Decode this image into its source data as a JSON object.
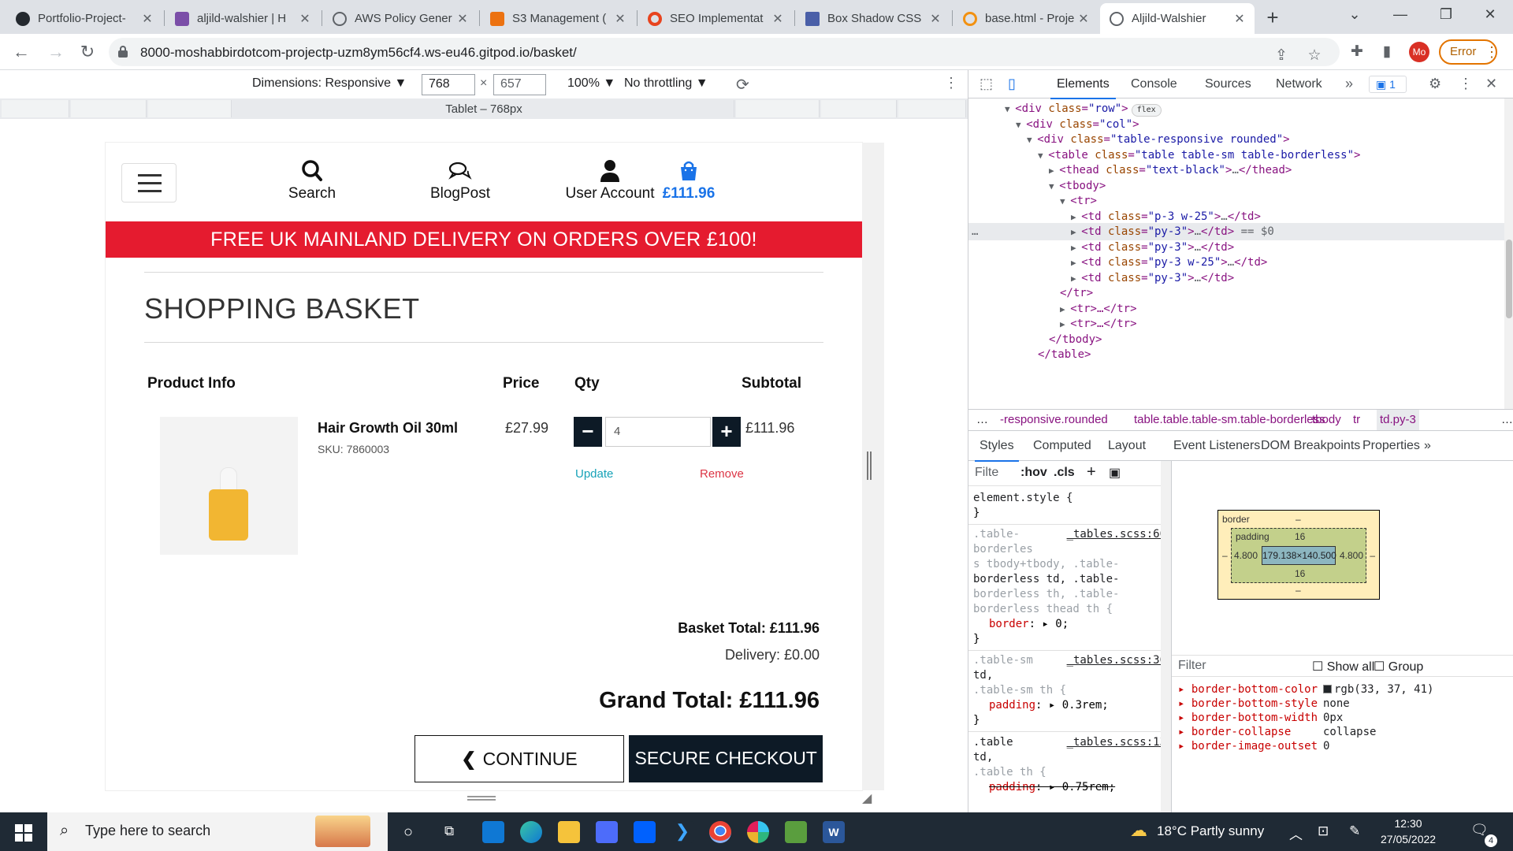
{
  "browser": {
    "tabs": [
      {
        "label": "Portfolio-Project-",
        "color": "#24292f"
      },
      {
        "label": "aljild-walshier | H",
        "color": "#7b4ea8"
      },
      {
        "label": "AWS Policy Gener",
        "color": "#5f6368"
      },
      {
        "label": "S3 Management (",
        "color": "#ec7211"
      },
      {
        "label": "SEO Implementat",
        "color": "#e8431e"
      },
      {
        "label": "Box Shadow CSS",
        "color": "#4a5fa8"
      },
      {
        "label": "base.html - Proje",
        "color": "#f29111"
      },
      {
        "label": "Aljild-Walshier",
        "color": "#5f6368"
      }
    ],
    "url": "8000-moshabbirdotcom-projectp-uzm8ym56cf4.ws-eu46.gitpod.io/basket/",
    "profile_initials": "Mo",
    "error_label": "Error"
  },
  "device_toolbar": {
    "dimensions_label": "Dimensions: Responsive ▼",
    "width": "768",
    "height": "657",
    "zoom": "100% ▼",
    "throttling": "No throttling ▼",
    "media_query_label": "Tablet – 768px"
  },
  "site": {
    "nav": {
      "search": "Search",
      "blog": "BlogPost",
      "account": "User Account",
      "cart_total": "£111.96"
    },
    "promo_banner": "FREE UK MAINLAND DELIVERY ON ORDERS OVER £100!",
    "page_title": "SHOPPING BASKET",
    "table_headers": {
      "product": "Product Info",
      "price": "Price",
      "qty": "Qty",
      "subtotal": "Subtotal"
    },
    "item": {
      "name": "Hair Growth Oil 30ml",
      "sku": "SKU: 7860003",
      "price": "£27.99",
      "qty": "4",
      "subtotal": "£111.96",
      "update": "Update",
      "remove": "Remove",
      "minus": "−",
      "plus": "+"
    },
    "totals": {
      "basket_total": "Basket Total: £111.96",
      "delivery": "Delivery: £0.00",
      "grand_total": "Grand Total: £111.96"
    },
    "buttons": {
      "continue": "CONTINUE SHOPPING",
      "checkout": "SECURE CHECKOUT"
    }
  },
  "devtools": {
    "tabs": [
      "Elements",
      "Console",
      "Sources",
      "Network"
    ],
    "issues_count": "1",
    "dom_lines": [
      {
        "indent": 0,
        "tri": "▼",
        "tag": "div",
        "attrs": [
          [
            "class",
            "row"
          ]
        ],
        "badge": "flex",
        "close": false
      },
      {
        "indent": 1,
        "tri": "▼",
        "tag": "div",
        "attrs": [
          [
            "class",
            "col"
          ]
        ],
        "close": false
      },
      {
        "indent": 2,
        "tri": "▼",
        "tag": "div",
        "attrs": [
          [
            "class",
            "table-responsive rounded"
          ]
        ],
        "close": false
      },
      {
        "indent": 3,
        "tri": "▼",
        "tag": "table",
        "attrs": [
          [
            "class",
            "table table-sm table-borderless"
          ]
        ],
        "close": false
      },
      {
        "indent": 4,
        "tri": "▶",
        "tag": "thead",
        "attrs": [
          [
            "class",
            "text-black"
          ]
        ],
        "close": true
      },
      {
        "indent": 4,
        "tri": "▼",
        "tag": "tbody",
        "attrs": [],
        "close": false
      },
      {
        "indent": 5,
        "tri": "▼",
        "tag": "tr",
        "attrs": [],
        "close": false
      },
      {
        "indent": 6,
        "tri": "▶",
        "tag": "td",
        "attrs": [
          [
            "class",
            "p-3 w-25"
          ]
        ],
        "close": true
      },
      {
        "indent": 6,
        "tri": "▶",
        "tag": "td",
        "attrs": [
          [
            "class",
            "py-3"
          ]
        ],
        "close": true,
        "selected": true,
        "suffix": " == $0"
      },
      {
        "indent": 6,
        "tri": "▶",
        "tag": "td",
        "attrs": [
          [
            "class",
            "py-3"
          ]
        ],
        "close": true
      },
      {
        "indent": 6,
        "tri": "▶",
        "tag": "td",
        "attrs": [
          [
            "class",
            "py-3 w-25"
          ]
        ],
        "close": true
      },
      {
        "indent": 6,
        "tri": "▶",
        "tag": "td",
        "attrs": [
          [
            "class",
            "py-3"
          ]
        ],
        "close": true
      },
      {
        "indent": 5,
        "tri": "",
        "raw": "</tr>"
      },
      {
        "indent": 5,
        "tri": "▶",
        "raw": "<tr>…</tr>"
      },
      {
        "indent": 5,
        "tri": "▶",
        "raw": "<tr>…</tr>"
      },
      {
        "indent": 4,
        "tri": "",
        "raw": "</tbody>"
      },
      {
        "indent": 3,
        "tri": "",
        "raw": "</table>"
      }
    ],
    "breadcrumbs": [
      "…",
      "-responsive.rounded",
      "table.table.table-sm.table-borderless",
      "tbody",
      "tr",
      "td.py-3",
      "…"
    ],
    "sub_tabs": [
      "Styles",
      "Computed",
      "Layout",
      "Event Listeners",
      "DOM Breakpoints",
      "Properties"
    ],
    "styles_filter_placeholder": "Filte",
    "styles_hov": ":hov",
    "styles_cls": ".cls",
    "css_rules": {
      "element_style": "element.style {",
      "r1_selector_a": ".table-",
      "r1_selector_b": "borderles",
      "r1_selector_c": "s tbody+tbody, .table-",
      "r1_selector_d": "borderless td, .table-",
      "r1_selector_e": "borderless th, .table-",
      "r1_selector_f": "borderless thead th {",
      "r1_src": "_tables.scss:66",
      "r1_prop": "border",
      "r1_val": "0;",
      "r2_selector_a": ".table-sm",
      "r2_selector_b": "td,",
      "r2_selector_c": ".table-sm th {",
      "r2_src": "_tables.scss:36",
      "r2_prop": "padding",
      "r2_val": "0.3rem;",
      "r3_selector_a": ".table",
      "r3_selector_b": "td,",
      "r3_selector_c": ".table th {",
      "r3_src": "_tables.scss:13",
      "r3_prop": "padding",
      "r3_val": "0.75rem;",
      "close_brace": "}"
    },
    "box_model": {
      "border_label": "border",
      "border_val": "–",
      "padding_label": "padding",
      "padding_top": "16",
      "padding_bottom": "16",
      "padding_left": "4.800",
      "padding_right": "4.800",
      "margin_left": "–",
      "margin_right": "–",
      "content": "179.138×140.500"
    },
    "computed": {
      "filter_placeholder": "Filter",
      "show_all": "Show all",
      "group": "Group",
      "rows": [
        {
          "prop": "border-bottom-color",
          "val": "rgb(33, 37, 41)",
          "swatch": true
        },
        {
          "prop": "border-bottom-style",
          "val": "none"
        },
        {
          "prop": "border-bottom-width",
          "val": "0px"
        },
        {
          "prop": "border-collapse",
          "val": "collapse"
        },
        {
          "prop": "border-image-outset",
          "val": "0"
        }
      ]
    }
  },
  "taskbar": {
    "search_placeholder": "Type here to search",
    "weather": "18°C  Partly sunny",
    "time": "12:30",
    "date": "27/05/2022",
    "notifications": "4"
  }
}
